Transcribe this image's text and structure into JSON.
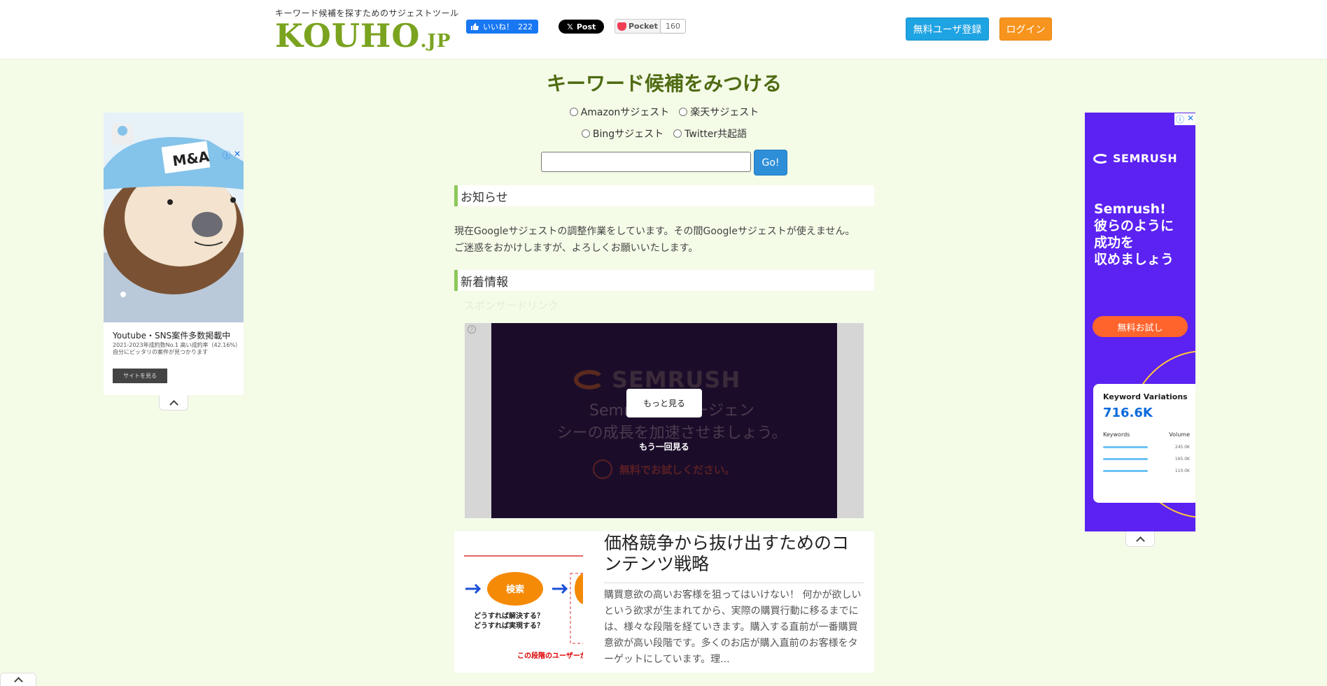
{
  "header": {
    "tagline": "キーワード候補を探すためのサジェストツール",
    "logo_main": "KOUHO",
    "logo_suffix": ".JP",
    "fb_like_label": "いいね！",
    "fb_like_count": "222",
    "x_post_label": "Post",
    "pocket_label": "Pocket",
    "pocket_count": "160",
    "register_label": "無料ユーザ登録",
    "login_label": "ログイン"
  },
  "main": {
    "title": "キーワード候補をみつける",
    "radio_options": [
      "Amazonサジェスト",
      "楽天サジェスト",
      "Bingサジェスト",
      "Twitter共起語"
    ],
    "search_value": "",
    "go_label": "Go!",
    "notice_heading": "お知らせ",
    "notice_line1": "現在Googleサジェストの調整作業をしています。その間Googleサジェストが使えません。",
    "notice_line2": "ご迷惑をおかけしますが、よろしくお願いいたします。",
    "news_heading": "新着情報",
    "sponsored_label": "スポンサードリンク"
  },
  "video_ad": {
    "brand": "SEMRUSH",
    "text_line1": "Semrushを エージェン",
    "text_line2": "シーの成長を加速させましょう。",
    "cta": "無料でお試しください。",
    "more_label": "もっと見る",
    "replay_label": "もう一回見る"
  },
  "article": {
    "title": "価格競争から抜け出すためのコンテンツ戦略",
    "body": "購買意欲の高いお客様を狙ってはいけない！ 何かが欲しいという欲求が生まれてから、実際の購買行動に移るまでには、様々な段階を経ていきます。購入する直前が一番購買意欲が高い段階です。多くのお店が購入直前のお客様をターゲットにしています。理...",
    "img_bubble": "検索",
    "img_caption1": "どうすれば解決する？",
    "img_caption2": "どうすれば実現する？",
    "img_red": "この段階のユーザーが"
  },
  "left_ad": {
    "badge": "M&A",
    "title": "Youtube・SNS案件多数掲載中",
    "sub": "2021-2023年成約数No.1 高い成約率（42.16%） 自分にピッタリの案件が見つかります",
    "button": "サイトを見る"
  },
  "right_ad": {
    "brand": "SEMRUSH",
    "headline": [
      "Semrush!",
      "彼らのように",
      "成功を",
      "収めましょう"
    ],
    "cta": "無料お試し",
    "card_title": "Keyword Variations",
    "card_number": "716.6K",
    "col_keywords": "Keywords",
    "col_volume": "Volume",
    "rows": [
      "245.0K",
      "165.0K",
      "110.0K"
    ]
  },
  "colors": {
    "accent_green": "#7aa31f",
    "title_green": "#4f6b12",
    "register_blue": "#1ea3e3",
    "login_orange": "#f7941d",
    "semrush_purple": "#5b22f1",
    "semrush_orange": "#ff642d"
  }
}
